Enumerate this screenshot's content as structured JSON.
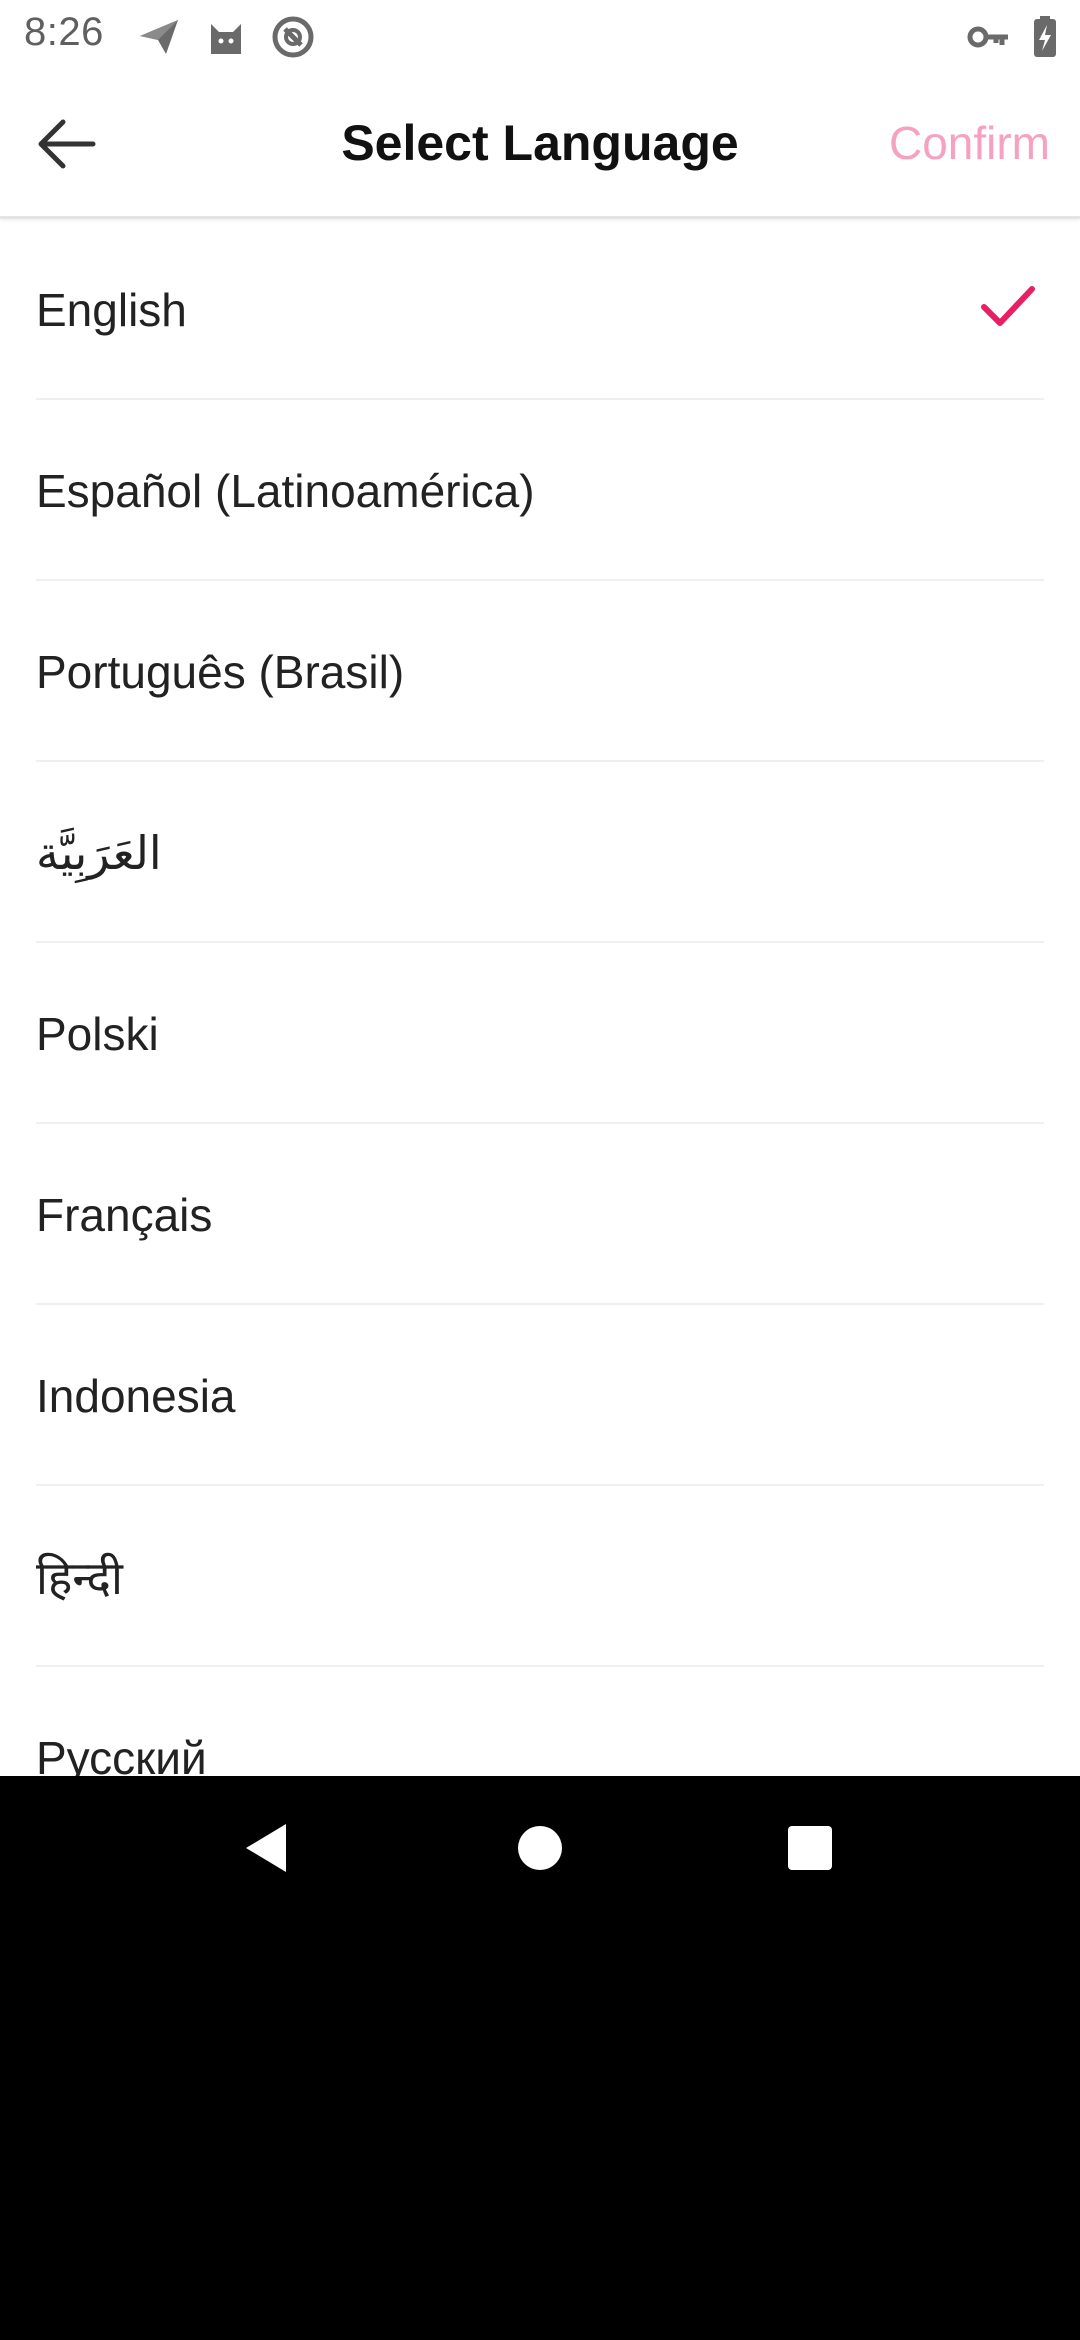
{
  "status_bar": {
    "time": "8:26",
    "icons": [
      "send-icon",
      "cat-icon",
      "no-sync-icon",
      "key-icon",
      "battery-charging-icon"
    ]
  },
  "app_bar": {
    "title": "Select Language",
    "confirm_label": "Confirm",
    "back_icon": "arrow-left-icon"
  },
  "colors": {
    "accent": "#e91e63",
    "confirm": "#f7a1c1",
    "text": "#222222",
    "divider": "#f0f0f0"
  },
  "languages": [
    {
      "label": "English",
      "selected": true
    },
    {
      "label": "Español (Latinoamérica)",
      "selected": false
    },
    {
      "label": "Português (Brasil)",
      "selected": false
    },
    {
      "label": "العَرَبِيَّة",
      "selected": false
    },
    {
      "label": "Polski",
      "selected": false
    },
    {
      "label": "Français",
      "selected": false
    },
    {
      "label": "Indonesia",
      "selected": false
    },
    {
      "label": "हिन्दी",
      "selected": false
    },
    {
      "label": "Русский",
      "selected": false
    }
  ],
  "nav_bar": {
    "buttons": [
      "back-triangle-icon",
      "home-circle-icon",
      "recents-square-icon"
    ]
  }
}
